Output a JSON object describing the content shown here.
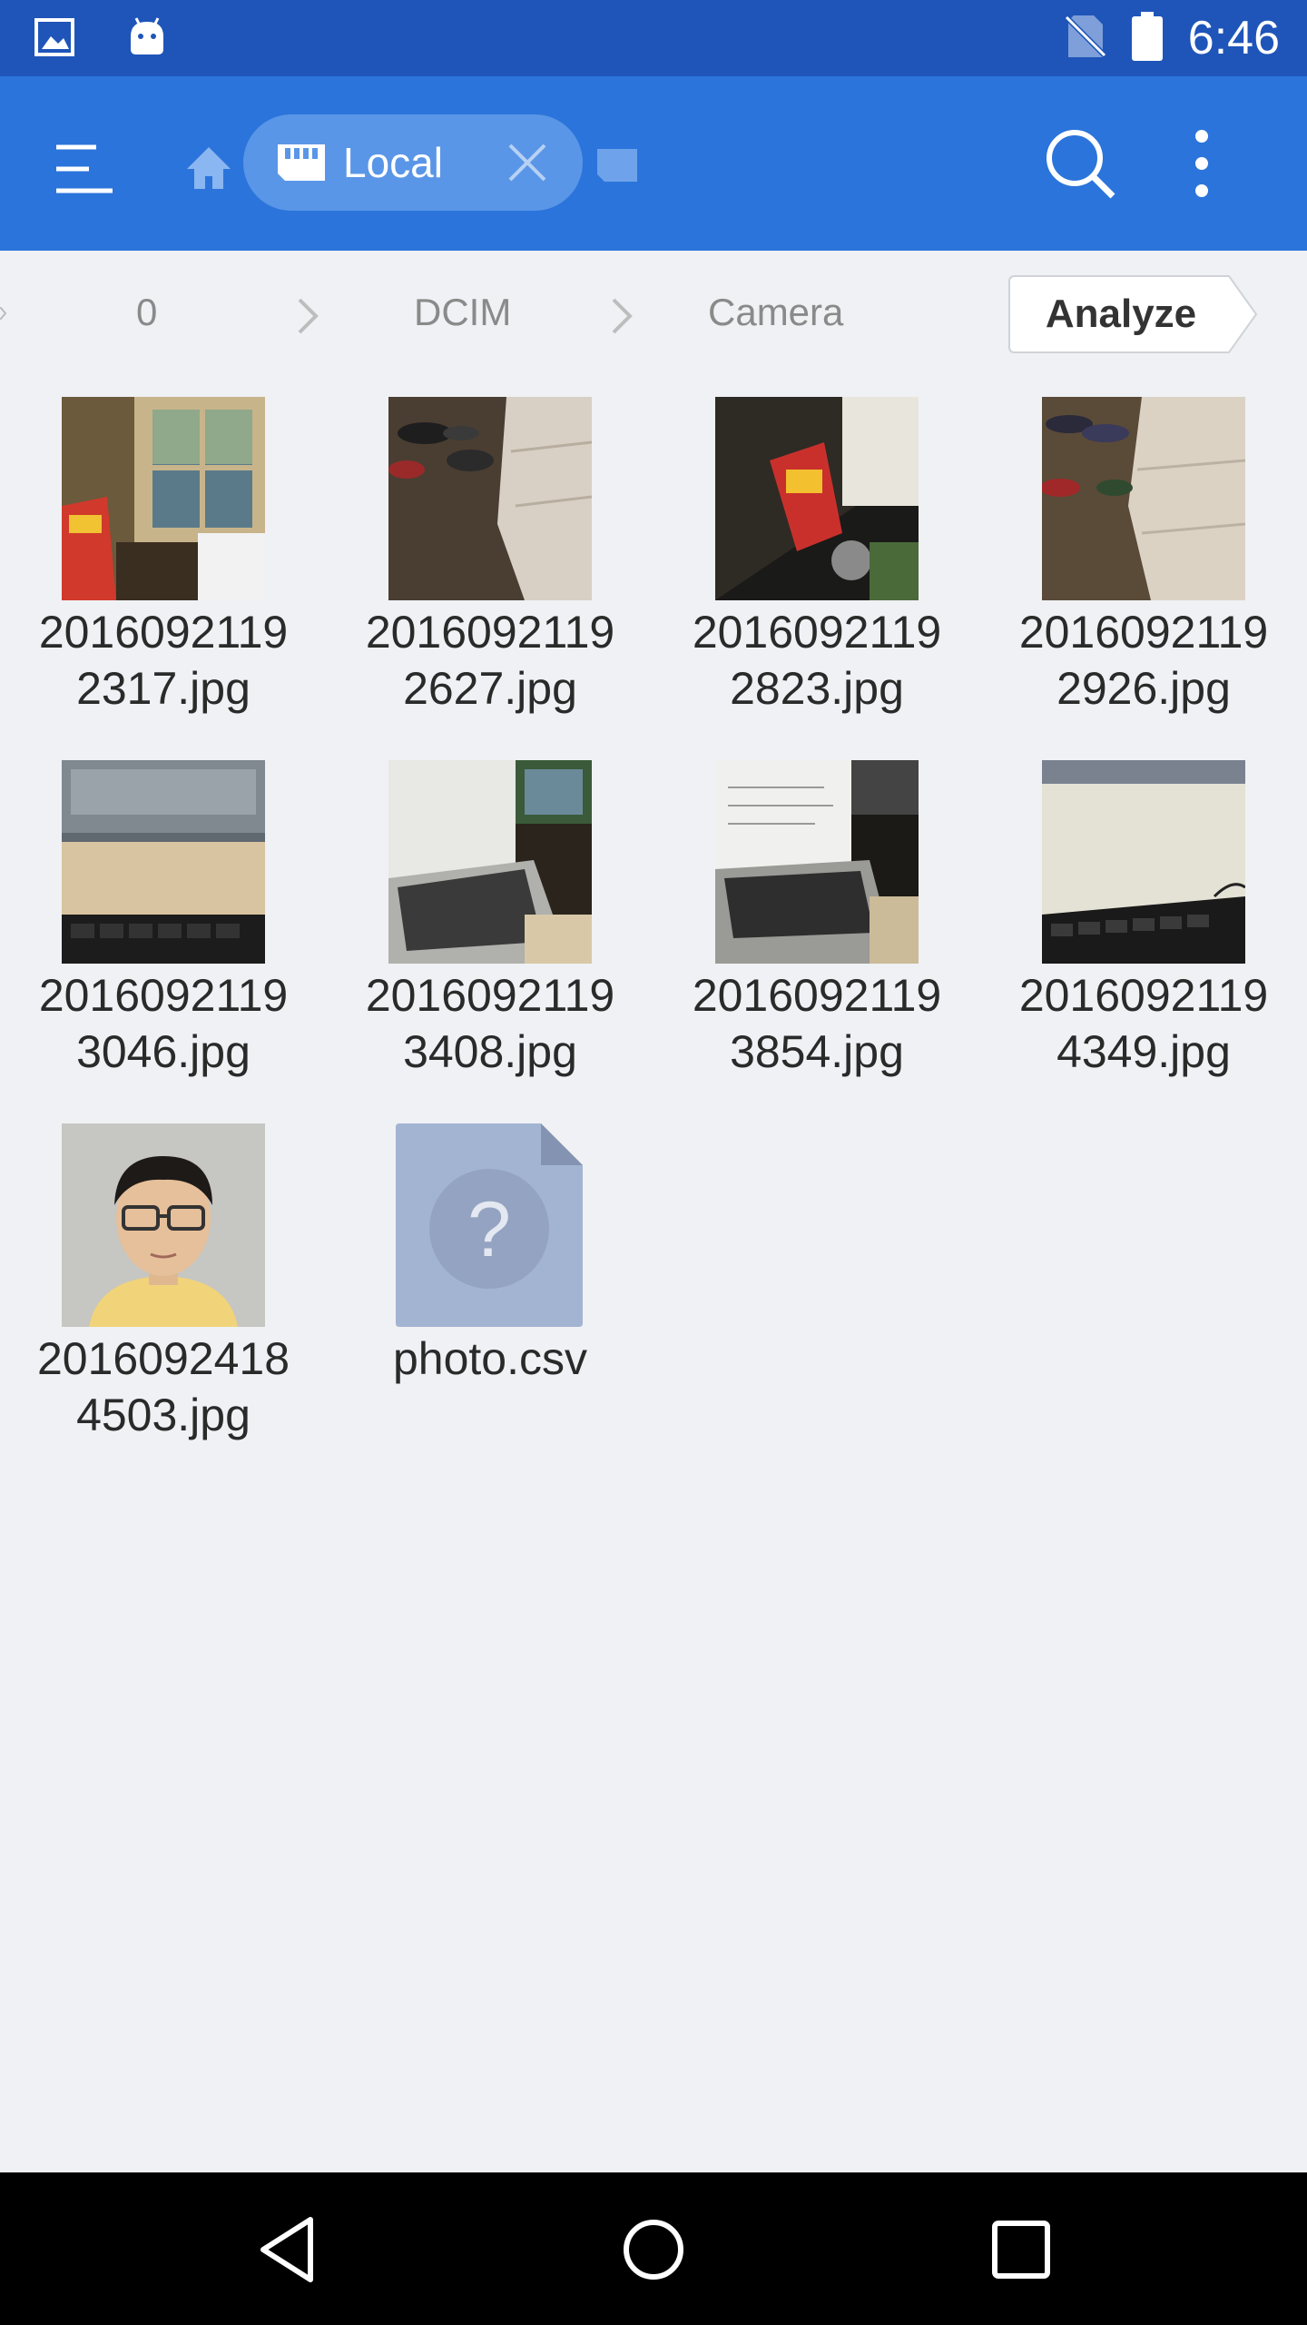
{
  "status_bar": {
    "time": "6:46",
    "icons": [
      "image-notification-icon",
      "android-notification-icon",
      "no-sim-icon",
      "battery-icon"
    ]
  },
  "app_bar": {
    "tab_label": "Local",
    "icons": [
      "menu-icon",
      "home-icon",
      "storage-icon",
      "close-icon",
      "search-icon",
      "more-vert-icon"
    ]
  },
  "breadcrumb": {
    "items": [
      "0",
      "DCIM",
      "Camera"
    ],
    "analyze_label": "Analyze"
  },
  "files": [
    {
      "name": "20160921192317.jpg",
      "line1": "2016092119",
      "line2": "2317.jpg",
      "kind": "photo",
      "scene": "window-chips"
    },
    {
      "name": "20160921192627.jpg",
      "line1": "2016092119",
      "line2": "2627.jpg",
      "kind": "photo",
      "scene": "shoes-drawer"
    },
    {
      "name": "20160921192823.jpg",
      "line1": "2016092119",
      "line2": "2823.jpg",
      "kind": "photo",
      "scene": "chips-dark"
    },
    {
      "name": "20160921192926.jpg",
      "line1": "2016092119",
      "line2": "2926.jpg",
      "kind": "photo",
      "scene": "shoes-drawer-2"
    },
    {
      "name": "20160921193046.jpg",
      "line1": "2016092119",
      "line2": "3046.jpg",
      "kind": "photo",
      "scene": "laptop-keyboard"
    },
    {
      "name": "20160921193408.jpg",
      "line1": "2016092119",
      "line2": "3408.jpg",
      "kind": "photo",
      "scene": "laptop-screen"
    },
    {
      "name": "20160921193854.jpg",
      "line1": "2016092119",
      "line2": "3854.jpg",
      "kind": "photo",
      "scene": "laptop-screen-2"
    },
    {
      "name": "20160921194349.jpg",
      "line1": "2016092119",
      "line2": "4349.jpg",
      "kind": "photo",
      "scene": "keyboard-desk"
    },
    {
      "name": "20160924184503.jpg",
      "line1": "2016092418",
      "line2": "4503.jpg",
      "kind": "photo",
      "scene": "portrait"
    },
    {
      "name": "photo.csv",
      "line1": "photo.csv",
      "line2": "",
      "kind": "unknown-file",
      "scene": "unknown-file-icon"
    }
  ],
  "nav_bar": {
    "icons": [
      "back-icon",
      "home-circle-icon",
      "recents-icon"
    ]
  },
  "colors": {
    "status_bar": "#1f55b9",
    "app_bar": "#2b74db",
    "tab_pill": "#5a96e7",
    "background": "#eff1f4",
    "unknown_file": "#a3b4d3"
  }
}
